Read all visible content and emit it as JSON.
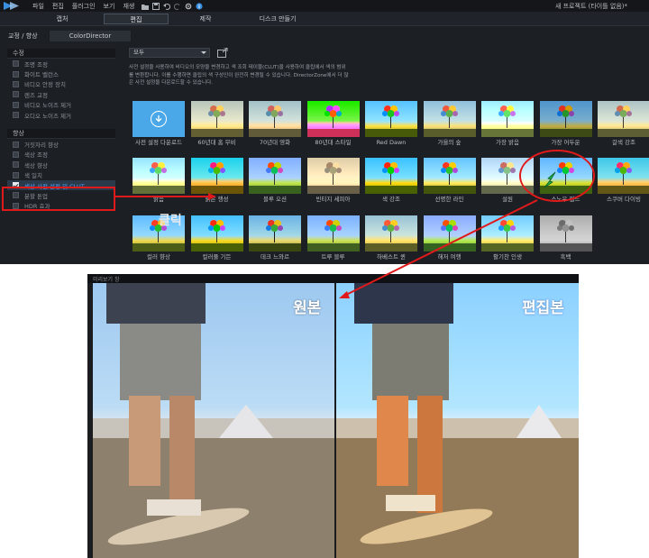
{
  "app": {
    "menus": [
      "파일",
      "편집",
      "플러그인",
      "보기",
      "재생"
    ],
    "project_title": "새 프로젝트 (타이틀 없음)*",
    "modes": [
      "캡처",
      "편집",
      "제작",
      "디스크 만들기"
    ],
    "active_mode": "편집",
    "room_label": "교정 / 향상",
    "room_tab": "ColorDirector"
  },
  "sidebar": {
    "sections": [
      {
        "title": "수정",
        "items": [
          {
            "label": "조명 조정",
            "checked": false
          },
          {
            "label": "화이트 밸런스",
            "checked": false
          },
          {
            "label": "비디오 안정 장치",
            "checked": false
          },
          {
            "label": "렌즈 교정",
            "checked": false
          },
          {
            "label": "비디오 노이즈 제거",
            "checked": false
          },
          {
            "label": "오디오 노이즈 제거",
            "checked": false
          }
        ]
      },
      {
        "title": "향상",
        "items": [
          {
            "label": "거짓자리 향상",
            "checked": false
          },
          {
            "label": "색상 조정",
            "checked": false
          },
          {
            "label": "색상 향상",
            "checked": false
          },
          {
            "label": "색 일치",
            "checked": false
          },
          {
            "label": "색상 사전 설정 및 CLUT",
            "checked": true,
            "selected": true
          },
          {
            "label": "분할 톤업",
            "checked": false
          },
          {
            "label": "HDR 효과",
            "checked": false
          }
        ]
      }
    ]
  },
  "content": {
    "filter": "모두",
    "description": "사전 설정을 사용하여 비디오의 모양을 변경하고 색 조회 테이블(CLUT)을 사용하여 클립에서 색의 범위를 변환합니다. 이를 수행하면 클립의 색 구성인이 완전히 변경될 수 있습니다. DirectorZone에서 더 많은 사전 설정을 다운로드할 수 있습니다.",
    "presets": [
      "사전 설정 다운로드",
      "60년대 홈 무비",
      "70년대 영화",
      "80년대 스타일",
      "Red Dawn",
      "가을의 숲",
      "가장 밝음",
      "가장 어두운",
      "갈색 강조",
      "밝음",
      "붉은 행성",
      "블루 오션",
      "빈티지 세피아",
      "색 강조",
      "선명한 라인",
      "설원",
      "스노우 필드",
      "스쿠버 다이빙",
      "컬러 향상",
      "컬러풀 기든",
      "데크 느와르",
      "트루 블루",
      "하베스트 퀸",
      "해저 여행",
      "활기찬 인생",
      "흑백"
    ]
  },
  "preview": {
    "window_title": "미리보기 창",
    "original_label": "원본",
    "edited_label": "편집본"
  },
  "annotation": {
    "click_text": "클릭",
    "accent_color": "#e01a1a"
  }
}
